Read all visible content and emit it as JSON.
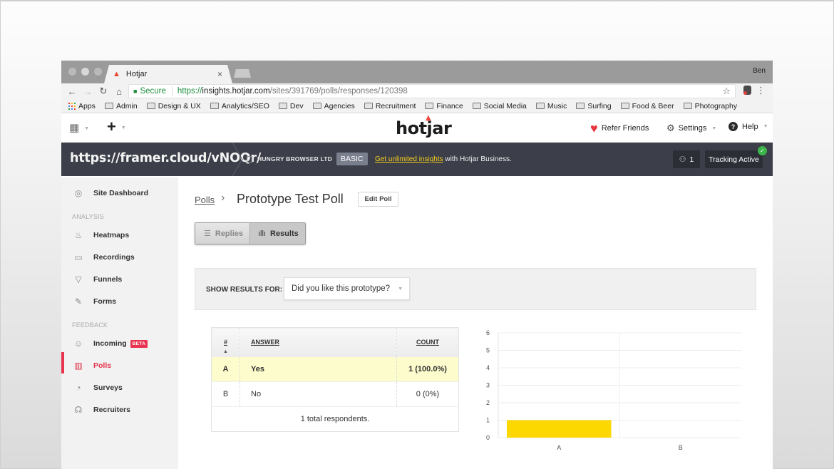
{
  "browser": {
    "tab_title": "Hotjar",
    "profile_name": "Ben",
    "url": {
      "secure_label": "Secure",
      "scheme": "https://",
      "host": "insights.hotjar.com",
      "path": "/sites/391769/polls/responses/120398"
    },
    "bookmarks": [
      "Apps",
      "Admin",
      "Design & UX",
      "Analytics/SEO",
      "Dev",
      "Agencies",
      "Recruitment",
      "Finance",
      "Social Media",
      "Music",
      "Surfing",
      "Food & Beer",
      "Photography"
    ]
  },
  "header": {
    "logo": "hotjar",
    "refer_label": "Refer Friends",
    "settings_label": "Settings",
    "help_label": "Help"
  },
  "sitebar": {
    "site_url": "https://framer.cloud/vNOQr/",
    "org_name": "HUNGRY BROWSER LTD",
    "plan": "BASIC",
    "upsell_link": "Get unlimited insights",
    "upsell_rest": " with Hotjar Business.",
    "visitor_count": "1",
    "tracking_label": "Tracking Active"
  },
  "sidebar": {
    "dashboard": "Site Dashboard",
    "analysis_heading": "ANALYSIS",
    "analysis_items": [
      "Heatmaps",
      "Recordings",
      "Funnels",
      "Forms"
    ],
    "feedback_heading": "FEEDBACK",
    "feedback_items": [
      "Incoming",
      "Polls",
      "Surveys",
      "Recruiters"
    ],
    "beta_badge": "BETA",
    "active_item": "Polls"
  },
  "main": {
    "breadcrumb_parent": "Polls",
    "title": "Prototype Test Poll",
    "edit_label": "Edit Poll",
    "view_tabs": {
      "replies": "Replies",
      "results": "Results",
      "active": "Results"
    },
    "filter_label": "SHOW RESULTS FOR:",
    "question_selected": "Did you like this prototype?",
    "table": {
      "headers": [
        "#",
        "ANSWER",
        "COUNT"
      ],
      "rows": [
        {
          "id": "A",
          "answer": "Yes",
          "count": "1 (100.0%)",
          "highlight": true
        },
        {
          "id": "B",
          "answer": "No",
          "count": "0 (0%)",
          "highlight": false
        }
      ],
      "total": "1 total respondents."
    }
  },
  "colors": {
    "accent": "#e8344f",
    "bar": "#fcd800",
    "highlight_row": "#fdfccd",
    "sitebar_bg": "#3c3f49"
  },
  "chart_data": {
    "type": "bar",
    "categories": [
      "A",
      "B"
    ],
    "values": [
      1,
      0
    ],
    "title": "",
    "xlabel": "",
    "ylabel": "",
    "ylim": [
      0,
      6
    ],
    "yticks": [
      0,
      1,
      2,
      3,
      4,
      5,
      6
    ],
    "grid": true
  }
}
